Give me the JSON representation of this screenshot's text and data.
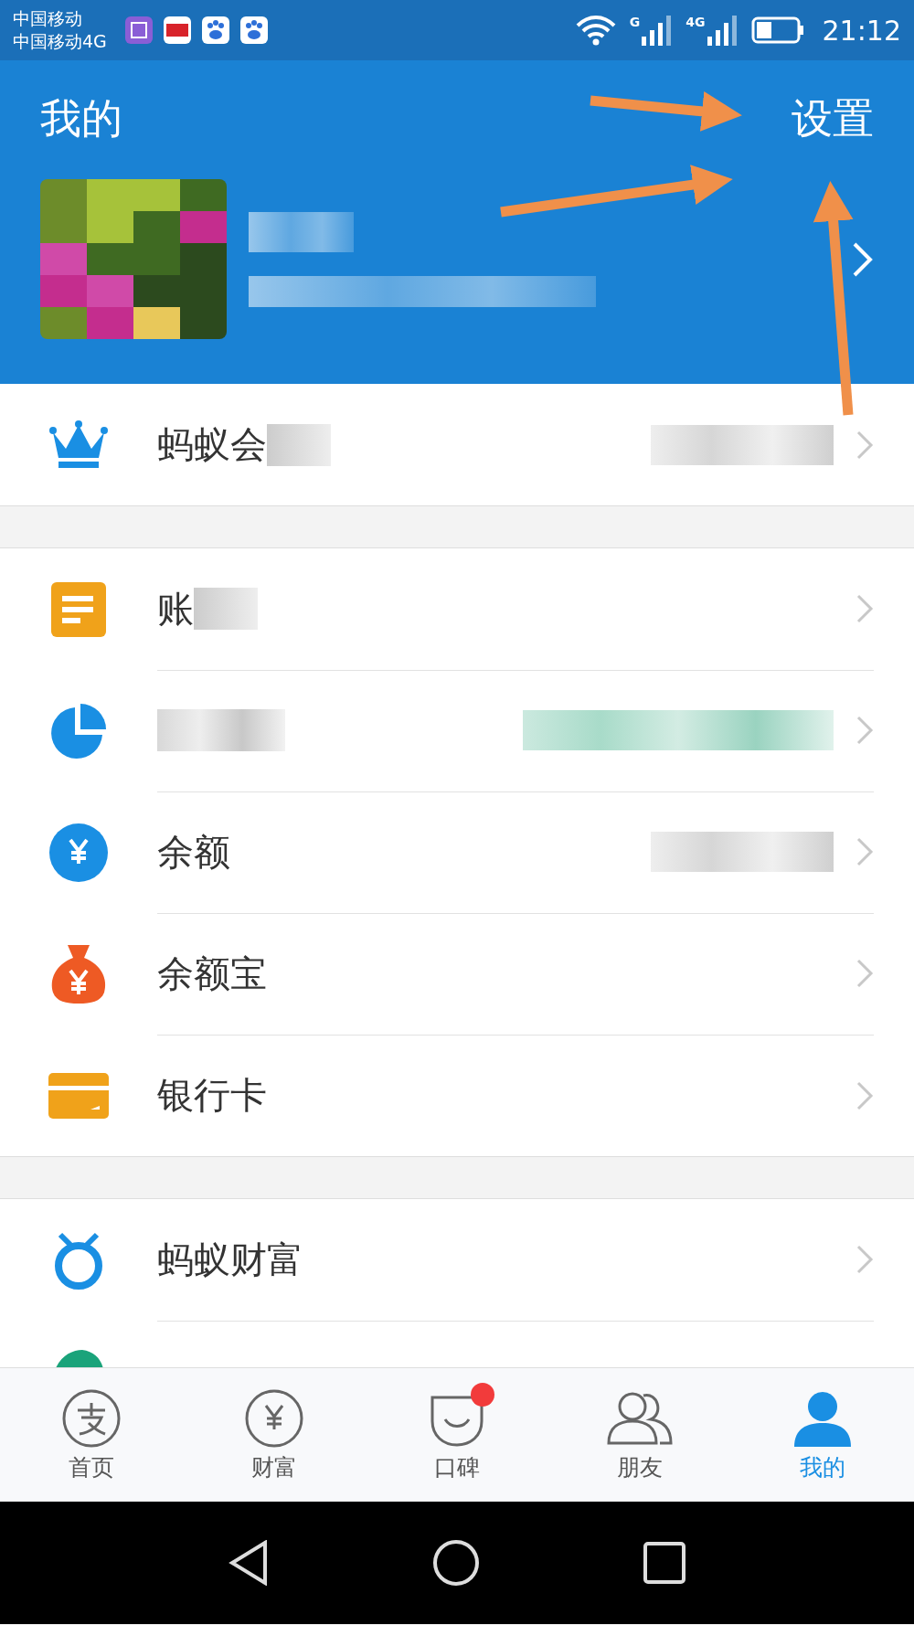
{
  "status_bar": {
    "carriers": [
      "中国移动",
      "中国移动4G"
    ],
    "network_labels": [
      "G",
      "4G"
    ],
    "time": "21:12"
  },
  "header": {
    "title": "我的",
    "settings": "设置",
    "profile": {
      "name_blurred": true,
      "account_blurred": true
    }
  },
  "sections": [
    {
      "items": [
        {
          "kind": "crown",
          "label": "蚂蚁会",
          "label_blurred": true,
          "value_blurred": true
        }
      ]
    },
    {
      "items": [
        {
          "kind": "bill",
          "label": "账",
          "label_blurred": true,
          "value_blurred": false
        },
        {
          "kind": "pie",
          "label_blurred": true,
          "value_blurred": true
        },
        {
          "kind": "yuan",
          "label": "余额",
          "label_blurred": false,
          "value_blurred": true
        },
        {
          "kind": "moneybag",
          "label": "余额宝",
          "label_blurred": false,
          "value_blurred": false
        },
        {
          "kind": "card",
          "label": "银行卡",
          "label_blurred": false,
          "value_blurred": false
        }
      ]
    },
    {
      "items": [
        {
          "kind": "wealth",
          "label": "蚂蚁财富",
          "label_blurred": false,
          "value_blurred": false
        },
        {
          "kind": "sesame",
          "label_blurred": false,
          "value_blurred": false
        }
      ]
    }
  ],
  "tabs": [
    {
      "kind": "pay",
      "label": "首页",
      "selected": false,
      "badge": false
    },
    {
      "kind": "fortune",
      "label": "财富",
      "selected": false,
      "badge": false
    },
    {
      "kind": "koubei",
      "label": "口碑",
      "selected": false,
      "badge": true
    },
    {
      "kind": "friends",
      "label": "朋友",
      "selected": false,
      "badge": false
    },
    {
      "kind": "me",
      "label": "我的",
      "selected": true,
      "badge": false
    }
  ]
}
